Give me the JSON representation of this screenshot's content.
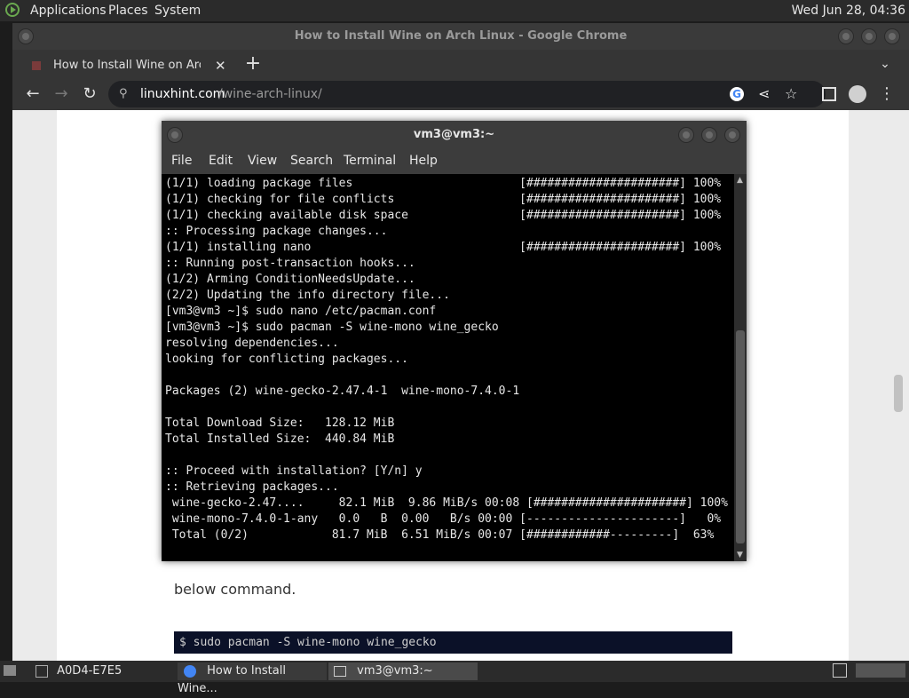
{
  "top_panel": {
    "applications": "Applications",
    "places": "Places",
    "system": "System",
    "clock": "Wed Jun 28, 04:36"
  },
  "chrome": {
    "window_title": "How to Install Wine on Arch Linux - Google Chrome",
    "tab_title": "How to Install Wine on Arch Li",
    "url_domain": "linuxhint.com",
    "url_path": "/wine-arch-linux/"
  },
  "page": {
    "partial_text": "below command.",
    "code": "$ sudo pacman -S wine-mono wine_gecko"
  },
  "terminal": {
    "title": "vm3@vm3:~",
    "menu": [
      "File",
      "Edit",
      "View",
      "Search",
      "Terminal",
      "Help"
    ],
    "lines": [
      "(1/1) loading package files                        [######################] 100%",
      "(1/1) checking for file conflicts                  [######################] 100%",
      "(1/1) checking available disk space                [######################] 100%",
      ":: Processing package changes...",
      "(1/1) installing nano                              [######################] 100%",
      ":: Running post-transaction hooks...",
      "(1/2) Arming ConditionNeedsUpdate...",
      "(2/2) Updating the info directory file...",
      "[vm3@vm3 ~]$ sudo nano /etc/pacman.conf",
      "[vm3@vm3 ~]$ sudo pacman -S wine-mono wine_gecko",
      "resolving dependencies...",
      "looking for conflicting packages...",
      "",
      "Packages (2) wine-gecko-2.47.4-1  wine-mono-7.4.0-1",
      "",
      "Total Download Size:   128.12 MiB",
      "Total Installed Size:  440.84 MiB",
      "",
      ":: Proceed with installation? [Y/n] y",
      ":: Retrieving packages...",
      " wine-gecko-2.47....     82.1 MiB  9.86 MiB/s 00:08 [######################] 100%",
      " wine-mono-7.4.0-1-any   0.0   B  0.00   B/s 00:00 [----------------------]   0%",
      " Total (0/2)            81.7 MiB  6.51 MiB/s 00:07 [############---------]  63%"
    ]
  },
  "taskbar": {
    "workspace": "A0D4-E7E5",
    "chrome_task": "How to Install Wine...",
    "terminal_task": "vm3@vm3:~"
  }
}
